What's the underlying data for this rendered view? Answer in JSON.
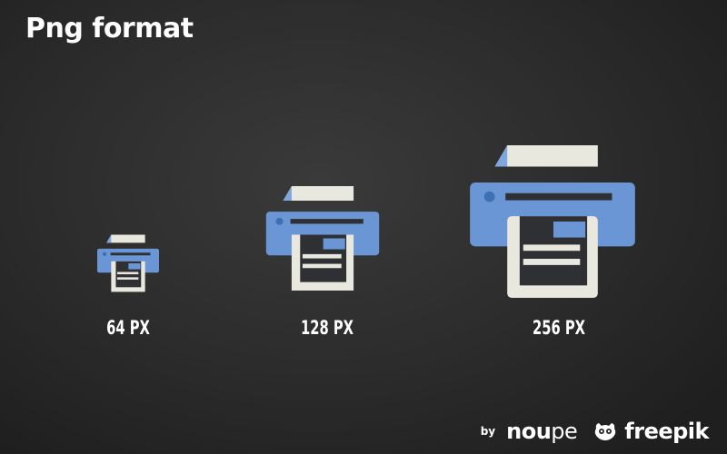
{
  "title": "Png format",
  "colors": {
    "background": "#2c2c2c",
    "printer_body": "#6a96d6",
    "printer_slot": "#2f3033",
    "paper": "#e9e8df",
    "paper_fold": "#bcbbb4",
    "paper_shade": "#7fa7de",
    "text": "#ffffff"
  },
  "icons": [
    {
      "label": "64 PX",
      "icon": "printer-icon"
    },
    {
      "label": "128 PX",
      "icon": "printer-icon"
    },
    {
      "label": "256 PX",
      "icon": "printer-icon"
    }
  ],
  "footer": {
    "by": "by",
    "noupe_bold": "nou",
    "noupe_light": "pe",
    "freepik": "freepik",
    "freepik_icon": "freepik-owl-icon"
  }
}
